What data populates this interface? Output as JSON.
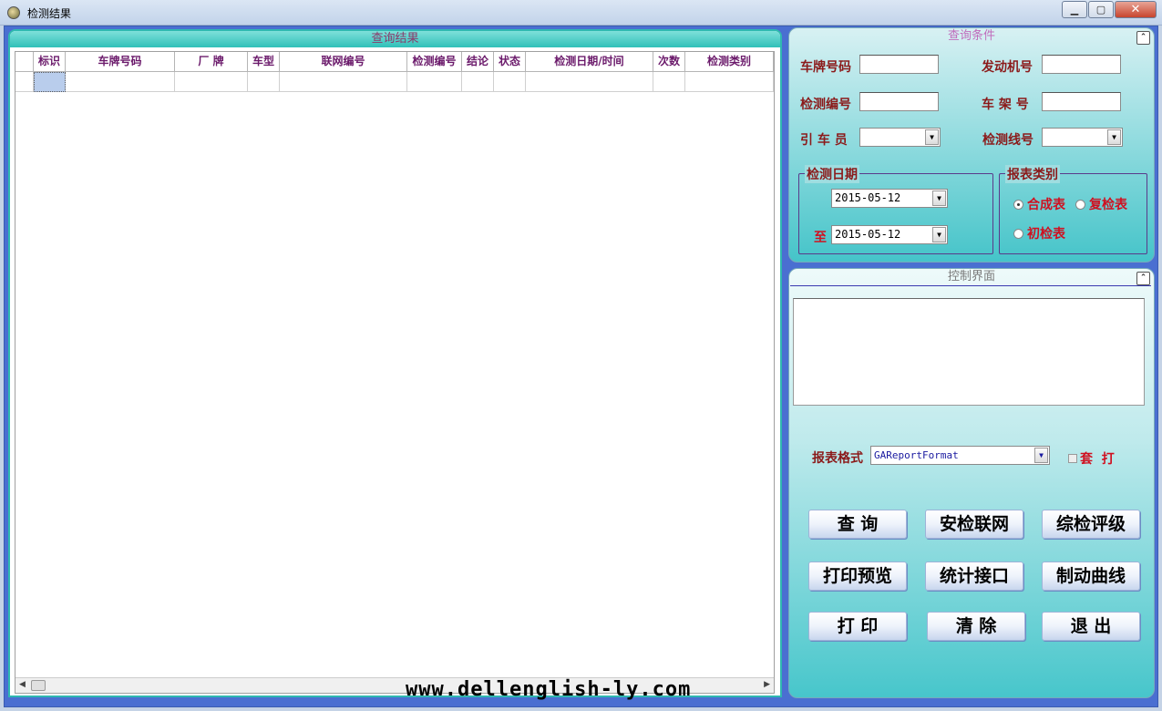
{
  "window": {
    "title": "检测结果"
  },
  "left": {
    "header": "查询结果",
    "columns": [
      "标识",
      "车牌号码",
      "厂  牌",
      "车型",
      "联网编号",
      "检测编号",
      "结论",
      "状态",
      "检测日期/时间",
      "次数",
      "检测类别"
    ]
  },
  "watermark": "www.dellenglish-ly.com",
  "query": {
    "title": "查询条件",
    "plate_label": "车牌号码",
    "engine_label": "发动机号",
    "test_no_label": "检测编号",
    "frame_label": "车 架 号",
    "driver_label": "引 车 员",
    "line_label": "检测线号",
    "date_group": "检测日期",
    "date_from": "2015-05-12",
    "to_label": "至",
    "date_to": "2015-05-12",
    "report_group": "报表类别",
    "report_types": [
      "合成表",
      "复检表",
      "初检表"
    ]
  },
  "control": {
    "title": "控制界面",
    "format_label": "报表格式",
    "format_value": "GAReportFormat",
    "set_print_label": "套  打",
    "buttons": [
      "查 询",
      "安检联网",
      "综检评级",
      "打印预览",
      "统计接口",
      "制动曲线",
      "打 印",
      "清 除",
      "退 出"
    ]
  }
}
